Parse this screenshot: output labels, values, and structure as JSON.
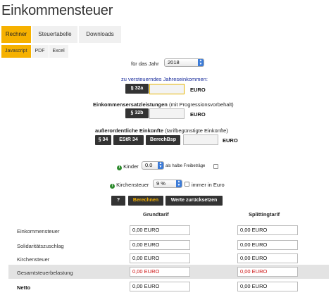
{
  "page": {
    "title": "Einkommensteuer"
  },
  "tabs": [
    {
      "label": "Rechner",
      "active": true
    },
    {
      "label": "Steuertabelle",
      "active": false
    },
    {
      "label": "Downloads",
      "active": false
    }
  ],
  "subtabs": [
    {
      "label": "Javascript",
      "active": true
    },
    {
      "label": "PDF",
      "active": false
    },
    {
      "label": "Excel",
      "active": false
    }
  ],
  "year": {
    "label": "für das Jahr",
    "value": "2018"
  },
  "income": {
    "label": "zu versteuerndes Jahreseinkommen:",
    "button": "§ 32a",
    "unit": "EURO",
    "value": ""
  },
  "replacement": {
    "label_bold": "Einkommensersatzleistungen",
    "label_rest": " (mit Progressionsvorbehalt)",
    "button": "§ 32b",
    "unit": "EURO",
    "value": ""
  },
  "extraordinary": {
    "label_bold": "außerordentliche Einkünfte",
    "label_rest": " (tarifbegünstigte Einkünfte)",
    "buttons": [
      "§ 34",
      "EStR 34",
      "BerechBsp"
    ],
    "unit": "EURO",
    "value": ""
  },
  "children": {
    "label": "Kinder",
    "value": "0.0",
    "suffix": "als halbe Freibeträge",
    "checked": false
  },
  "church": {
    "label": "Kirchensteuer",
    "value": "9 %",
    "suffix": "immer in Euro",
    "checked": false
  },
  "actions": {
    "help": "?",
    "calculate": "Berechnen",
    "reset": "Werte zurücksetzen"
  },
  "results": {
    "headers": {
      "grund": "Grundtarif",
      "splitting": "Splittingtarif"
    },
    "rows": [
      {
        "label": "Einkommensteuer",
        "grund": "0,00  EURO",
        "splitting": "0,00  EURO"
      },
      {
        "label": "Solidaritätszuschlag",
        "grund": "0,00  EURO",
        "splitting": "0,00  EURO"
      },
      {
        "label": "Kirchensteuer",
        "grund": "0,00  EURO",
        "splitting": "0,00  EURO"
      },
      {
        "label": "Gesamtsteuerbelastung",
        "grund": "0,00  EURO",
        "splitting": "0,00  EURO"
      },
      {
        "label": "Netto",
        "grund": "0,00  EURO",
        "splitting": "0,00  EURO"
      }
    ]
  },
  "colors": {
    "accent": "#f6b100",
    "dark_button": "#333333",
    "total_red": "#cc1111",
    "label_blue": "#1a2d9c"
  },
  "icons": {
    "info": "info-icon",
    "select_arrow": "select-arrow-icon"
  }
}
